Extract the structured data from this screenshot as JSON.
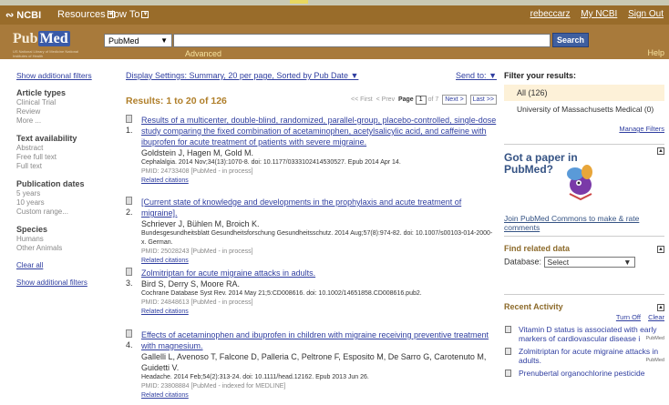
{
  "ncbi_bar": {
    "logo": "NCBI",
    "resources": "Resources",
    "howto": "How To",
    "user": "rebeccarz",
    "my_ncbi": "My NCBI",
    "sign_out": "Sign Out"
  },
  "search": {
    "logo_text_a": "Pub",
    "logo_text_b": "Med",
    "logo_sub": "US National Library of Medicine National Institutes of Health",
    "database": "PubMed",
    "query": "",
    "advanced": "Advanced",
    "button": "Search",
    "help": "Help"
  },
  "left": {
    "show_filters": "Show additional filters",
    "groups": [
      {
        "heading": "Article types",
        "options": [
          "Clinical Trial",
          "Review",
          "More ..."
        ]
      },
      {
        "heading": "Text availability",
        "options": [
          "Abstract",
          "Free full text",
          "Full text"
        ]
      },
      {
        "heading": "Publication dates",
        "options": [
          "5 years",
          "10 years",
          "Custom range..."
        ]
      },
      {
        "heading": "Species",
        "options": [
          "Humans",
          "Other Animals"
        ]
      }
    ],
    "clear_all": "Clear all",
    "show_filters2": "Show additional filters"
  },
  "main": {
    "display_settings": "Display Settings: Summary, 20 per page, Sorted by Pub Date",
    "send_to": "Send to:",
    "results_title": "Results: 1 to 20 of 126",
    "pager": {
      "first": "<< First",
      "prev": "< Prev",
      "page_label": "Page",
      "page": "1",
      "of": "of 7",
      "next": "Next >",
      "last": "Last >>"
    },
    "results": [
      {
        "num": "1.",
        "title": "Results of a multicenter, double-blind, randomized, parallel-group, placebo-controlled, single-dose study comparing the fixed combination of acetaminophen, acetylsalicylic acid, and caffeine with ibuprofen for acute treatment of patients with severe migraine.",
        "authors": "Goldstein J, Hagen M, Gold M.",
        "source": "Cephalalgia. 2014 Nov;34(13):1070-8. doi: 10.1177/0333102414530527. Epub 2014 Apr 14.",
        "pmid": "PMID: 24733408 [PubMed - in process]",
        "related": "Related citations"
      },
      {
        "num": "2.",
        "title": "[Current state of knowledge and developments in the prophylaxis and acute treatment of migraine].",
        "authors": "Schriever J, Bühlen M, Broich K.",
        "source": "Bundesgesundheitsblatt Gesundheitsforschung Gesundheitsschutz. 2014 Aug;57(8):974-82. doi: 10.1007/s00103-014-2000-x. German.",
        "pmid": "PMID: 25028243 [PubMed - in process]",
        "related": "Related citations"
      },
      {
        "num": "3.",
        "title": "Zolmitriptan for acute migraine attacks in adults.",
        "authors": "Bird S, Derry S, Moore RA.",
        "source": "Cochrane Database Syst Rev. 2014 May 21;5:CD008616. doi: 10.1002/14651858.CD008616.pub2.",
        "pmid": "PMID: 24848613 [PubMed - in process]",
        "related": "Related citations"
      },
      {
        "num": "4.",
        "title": "Effects of acetaminophen and ibuprofen in children with migraine receiving preventive treatment with magnesium.",
        "authors": "Gallelli L, Avenoso T, Falcone D, Palleria C, Peltrone F, Esposito M, De Sarro G, Carotenuto M, Guidetti V.",
        "source": "Headache. 2014 Feb;54(2):313-24. doi: 10.1111/head.12162. Epub 2013 Jun 26.",
        "pmid": "PMID: 23808884 [PubMed - indexed for MEDLINE]",
        "related": "Related citations"
      }
    ]
  },
  "right": {
    "filter_heading": "Filter your results:",
    "all": "All (126)",
    "umass": "University of Massachusetts Medical (0)",
    "manage": "Manage Filters",
    "paper_heading_1": "Got a paper in",
    "paper_heading_2": "PubMed?",
    "join": "Join PubMed Commons to make & rate comments",
    "related_heading": "Find related data",
    "database_label": "Database:",
    "database_value": "Select",
    "activity_heading": "Recent Activity",
    "turn_off": "Turn Off",
    "clear": "Clear",
    "activity": [
      {
        "text": "Vitamin D status is associated with early markers of cardiovascular disease i",
        "tag": "PubMed"
      },
      {
        "text": "Zolmitriptan for acute migraine attacks in adults.",
        "tag": "PubMed"
      },
      {
        "text": "Prenubertal organochlorine pesticide",
        "tag": ""
      }
    ]
  }
}
